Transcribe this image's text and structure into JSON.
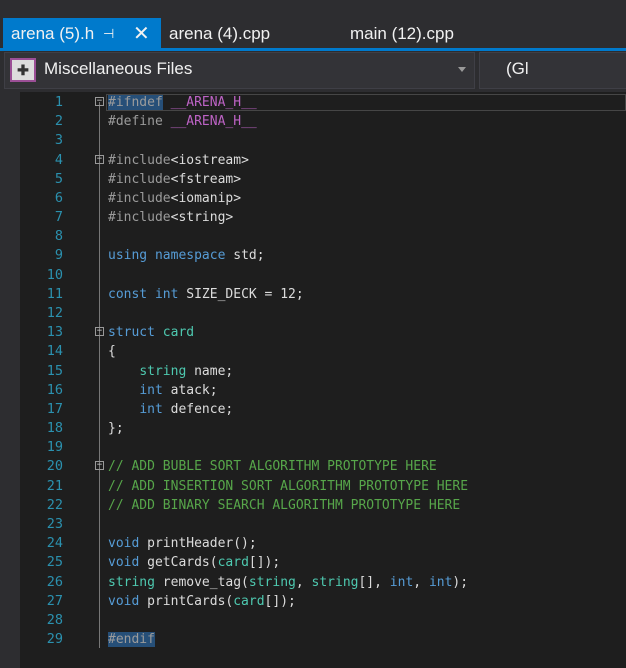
{
  "tabs": [
    {
      "label": "arena (5).h",
      "active": true
    },
    {
      "label": "arena (4).cpp"
    },
    {
      "label": "main (12).cpp"
    }
  ],
  "tab_pin_icon": "⊣",
  "tab_close_icon": "✕",
  "navbar": {
    "project": "Miscellaneous Files",
    "scope": "(Gl"
  },
  "colors": {
    "accent": "#007acc",
    "background": "#1e1e1e",
    "keyword": "#569cd6",
    "type": "#4ec9b0",
    "comment": "#57a64a",
    "macro": "#bd63c5",
    "line_number": "#2b91af"
  },
  "code_lines": [
    {
      "n": "1",
      "fold": true,
      "tokens": [
        [
          "#ifndef",
          "pp sel"
        ],
        [
          " ",
          "tx"
        ],
        [
          "__ARENA_H__",
          "mac"
        ]
      ]
    },
    {
      "n": "2",
      "tokens": [
        [
          "#define",
          "pp"
        ],
        [
          " ",
          "tx"
        ],
        [
          "__ARENA_H__",
          "mac"
        ]
      ]
    },
    {
      "n": "3",
      "tokens": []
    },
    {
      "n": "4",
      "fold": true,
      "tokens": [
        [
          "#include",
          "pp"
        ],
        [
          "<iostream>",
          "tx"
        ]
      ]
    },
    {
      "n": "5",
      "tokens": [
        [
          "#include",
          "pp"
        ],
        [
          "<fstream>",
          "tx"
        ]
      ]
    },
    {
      "n": "6",
      "tokens": [
        [
          "#include",
          "pp"
        ],
        [
          "<iomanip>",
          "tx"
        ]
      ]
    },
    {
      "n": "7",
      "tokens": [
        [
          "#include",
          "pp"
        ],
        [
          "<string>",
          "tx"
        ]
      ]
    },
    {
      "n": "8",
      "tokens": []
    },
    {
      "n": "9",
      "tokens": [
        [
          "using",
          "kw"
        ],
        [
          " ",
          "tx"
        ],
        [
          "namespace",
          "kw"
        ],
        [
          " std;",
          "tx"
        ]
      ]
    },
    {
      "n": "10",
      "tokens": []
    },
    {
      "n": "11",
      "tokens": [
        [
          "const",
          "kw"
        ],
        [
          " ",
          "tx"
        ],
        [
          "int",
          "kw"
        ],
        [
          " SIZE_DECK = 12;",
          "tx"
        ]
      ]
    },
    {
      "n": "12",
      "tokens": []
    },
    {
      "n": "13",
      "fold": true,
      "tokens": [
        [
          "struct",
          "kw"
        ],
        [
          " ",
          "tx"
        ],
        [
          "card",
          "ty"
        ]
      ]
    },
    {
      "n": "14",
      "tokens": [
        [
          "{",
          "tx"
        ]
      ]
    },
    {
      "n": "15",
      "tokens": [
        [
          "    ",
          "tx"
        ],
        [
          "string",
          "ty"
        ],
        [
          " name;",
          "tx"
        ]
      ]
    },
    {
      "n": "16",
      "tokens": [
        [
          "    ",
          "tx"
        ],
        [
          "int",
          "kw"
        ],
        [
          " atack;",
          "tx"
        ]
      ]
    },
    {
      "n": "17",
      "tokens": [
        [
          "    ",
          "tx"
        ],
        [
          "int",
          "kw"
        ],
        [
          " defence;",
          "tx"
        ]
      ]
    },
    {
      "n": "18",
      "tokens": [
        [
          "};",
          "tx"
        ]
      ]
    },
    {
      "n": "19",
      "tokens": []
    },
    {
      "n": "20",
      "fold": true,
      "tokens": [
        [
          "// ADD BUBLE SORT ALGORITHM PROTOTYPE HERE",
          "cm"
        ]
      ]
    },
    {
      "n": "21",
      "tokens": [
        [
          "// ADD INSERTION SORT ALGORITHM PROTOTYPE HERE",
          "cm"
        ]
      ]
    },
    {
      "n": "22",
      "tokens": [
        [
          "// ADD BINARY SEARCH ALGORITHM PROTOTYPE HERE",
          "cm"
        ]
      ]
    },
    {
      "n": "23",
      "tokens": []
    },
    {
      "n": "24",
      "tokens": [
        [
          "void",
          "kw"
        ],
        [
          " printHeader();",
          "tx"
        ]
      ]
    },
    {
      "n": "25",
      "tokens": [
        [
          "void",
          "kw"
        ],
        [
          " getCards(",
          "tx"
        ],
        [
          "card",
          "ty"
        ],
        [
          "[]);",
          "tx"
        ]
      ]
    },
    {
      "n": "26",
      "tokens": [
        [
          "string",
          "ty"
        ],
        [
          " remove_tag(",
          "tx"
        ],
        [
          "string",
          "ty"
        ],
        [
          ", ",
          "tx"
        ],
        [
          "string",
          "ty"
        ],
        [
          "[], ",
          "tx"
        ],
        [
          "int",
          "kw"
        ],
        [
          ", ",
          "tx"
        ],
        [
          "int",
          "kw"
        ],
        [
          ");",
          "tx"
        ]
      ]
    },
    {
      "n": "27",
      "tokens": [
        [
          "void",
          "kw"
        ],
        [
          " printCards(",
          "tx"
        ],
        [
          "card",
          "ty"
        ],
        [
          "[]);",
          "tx"
        ]
      ]
    },
    {
      "n": "28",
      "tokens": []
    },
    {
      "n": "29",
      "tokens": [
        [
          "#endif",
          "pp sel"
        ]
      ]
    }
  ]
}
